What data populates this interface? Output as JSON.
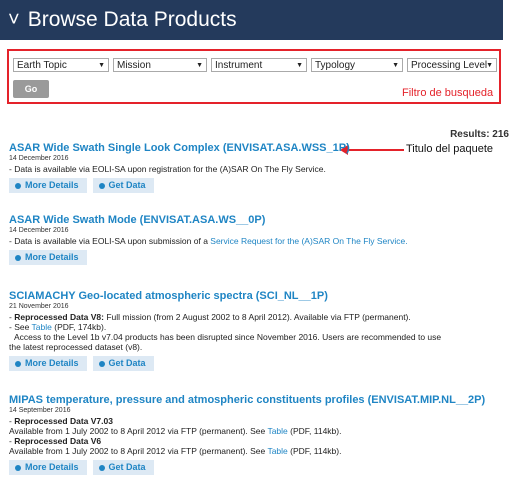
{
  "header": {
    "title": "Browse Data Products"
  },
  "filters": {
    "selects": [
      {
        "label": "Earth Topic"
      },
      {
        "label": "Mission"
      },
      {
        "label": "Instrument"
      },
      {
        "label": "Typology"
      },
      {
        "label": "Processing Level"
      }
    ],
    "go_label": "Go",
    "annotation": "Filtro de busqueda"
  },
  "results": {
    "text": "Results: 216"
  },
  "annotation": {
    "package_title": "Titulo del paquete"
  },
  "products": [
    {
      "title": "ASAR Wide Swath Single Look Complex (ENVISAT.ASA.WSS_1P)",
      "date": "14 December 2016",
      "desc": "Data is available via EOLI-SA upon registration for the (A)SAR On The Fly Service.",
      "more": "More Details",
      "get": "Get Data"
    },
    {
      "title": "ASAR Wide Swath Mode (ENVISAT.ASA.WS__0P)",
      "date": "14 December 2016",
      "desc_pre": "Data is available via EOLI-SA upon submission of a ",
      "desc_link": "Service Request for the (A)SAR On The Fly Service.",
      "more": "More Details"
    },
    {
      "title": "SCIAMACHY Geo-located atmospheric spectra (SCI_NL__1P)",
      "date": "21 November 2016",
      "line1_bold": "Reprocessed Data V8:",
      "line1": " Full mission (from 2 August 2002 to 8 April 2012). Available via FTP (permanent).",
      "line2_pre": "See ",
      "line2_link": "Table",
      "line2_post": " (PDF, 174kb).",
      "line3": "Access to the Level 1b v7.04 products has been disrupted since November 2016. Users are recommended to use",
      "line4": "the latest reprocessed dataset (v8).",
      "more": "More Details",
      "get": "Get Data"
    },
    {
      "title": "MIPAS temperature, pressure and atmospheric constituents profiles (ENVISAT.MIP.NL__2P)",
      "date": "14 September 2016",
      "a_bold": "Reprocessed Data V7.03",
      "a_pre": "Available from 1 July 2002 to 8 April 2012 via FTP (permanent). See ",
      "a_link": "Table",
      "a_post": " (PDF, 114kb).",
      "b_bold": "Reprocessed Data V6",
      "b_pre": "Available from 1 July 2002 to 8 April 2012 via FTP (permanent). See ",
      "b_link": "Table",
      "b_post": " (PDF, 114kb).",
      "more": "More Details",
      "get": "Get Data"
    }
  ]
}
